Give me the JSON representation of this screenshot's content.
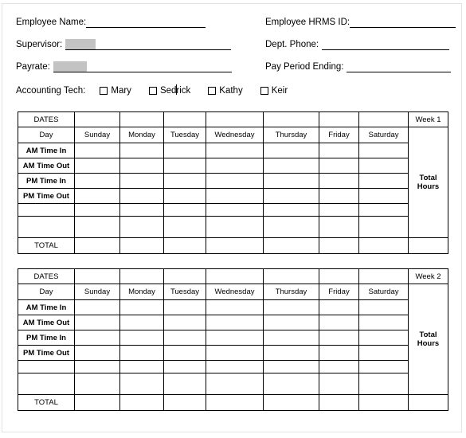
{
  "form": {
    "left_fields": [
      {
        "label": "Employee Name:",
        "value": "",
        "rule_width": 150,
        "highlight_width": 0
      },
      {
        "label": "Supervisor:",
        "value": "",
        "rule_width": 208,
        "highlight_width": 38
      },
      {
        "label": "Payrate:",
        "value": "",
        "rule_width": 224,
        "highlight_width": 42
      }
    ],
    "right_fields": [
      {
        "label": "Employee HRMS ID:",
        "value": "",
        "rule_width": 133
      },
      {
        "label": "Dept. Phone:",
        "value": "",
        "rule_width": 160
      },
      {
        "label": "Pay Period Ending:",
        "value": "",
        "rule_width": 131
      }
    ],
    "accounting_tech": {
      "label": "Accounting Tech:",
      "options": [
        {
          "name": "Mary",
          "checked": false
        },
        {
          "name": "Sedrick",
          "checked": false,
          "caret_after_chars": 4
        },
        {
          "name": "Kathy",
          "checked": false
        },
        {
          "name": "Keir",
          "checked": false
        }
      ]
    }
  },
  "timesheets": [
    {
      "week_label": "Week 1",
      "dates_label": "DATES",
      "day_label": "Day",
      "days": [
        "Sunday",
        "Monday",
        "Tuesday",
        "Wednesday",
        "Thursday",
        "Friday",
        "Saturday"
      ],
      "dates_values": [
        "",
        "",
        "",
        "",
        "",
        "",
        ""
      ],
      "row_labels": [
        "AM Time In",
        "AM Time Out",
        "PM Time In",
        "PM Time Out",
        "",
        ""
      ],
      "total_label": "TOTAL",
      "total_hours_label": "Total Hours",
      "total_values": [
        "",
        "",
        "",
        "",
        "",
        "",
        ""
      ],
      "total_hours_value": ""
    },
    {
      "week_label": "Week 2",
      "dates_label": "DATES",
      "day_label": "Day",
      "days": [
        "Sunday",
        "Monday",
        "Tuesday",
        "Wednesday",
        "Thursday",
        "Friday",
        "Saturday"
      ],
      "dates_values": [
        "",
        "",
        "",
        "",
        "",
        "",
        ""
      ],
      "row_labels": [
        "AM Time In",
        "AM Time Out",
        "PM Time In",
        "PM Time Out",
        "",
        ""
      ],
      "total_label": "TOTAL",
      "total_hours_label": "Total Hours",
      "total_values": [
        "",
        "",
        "",
        "",
        "",
        "",
        ""
      ],
      "total_hours_value": ""
    }
  ],
  "colors": {
    "ink": "#000000",
    "highlight": "#c3c3c3",
    "page_border": "#e3e3e3"
  }
}
